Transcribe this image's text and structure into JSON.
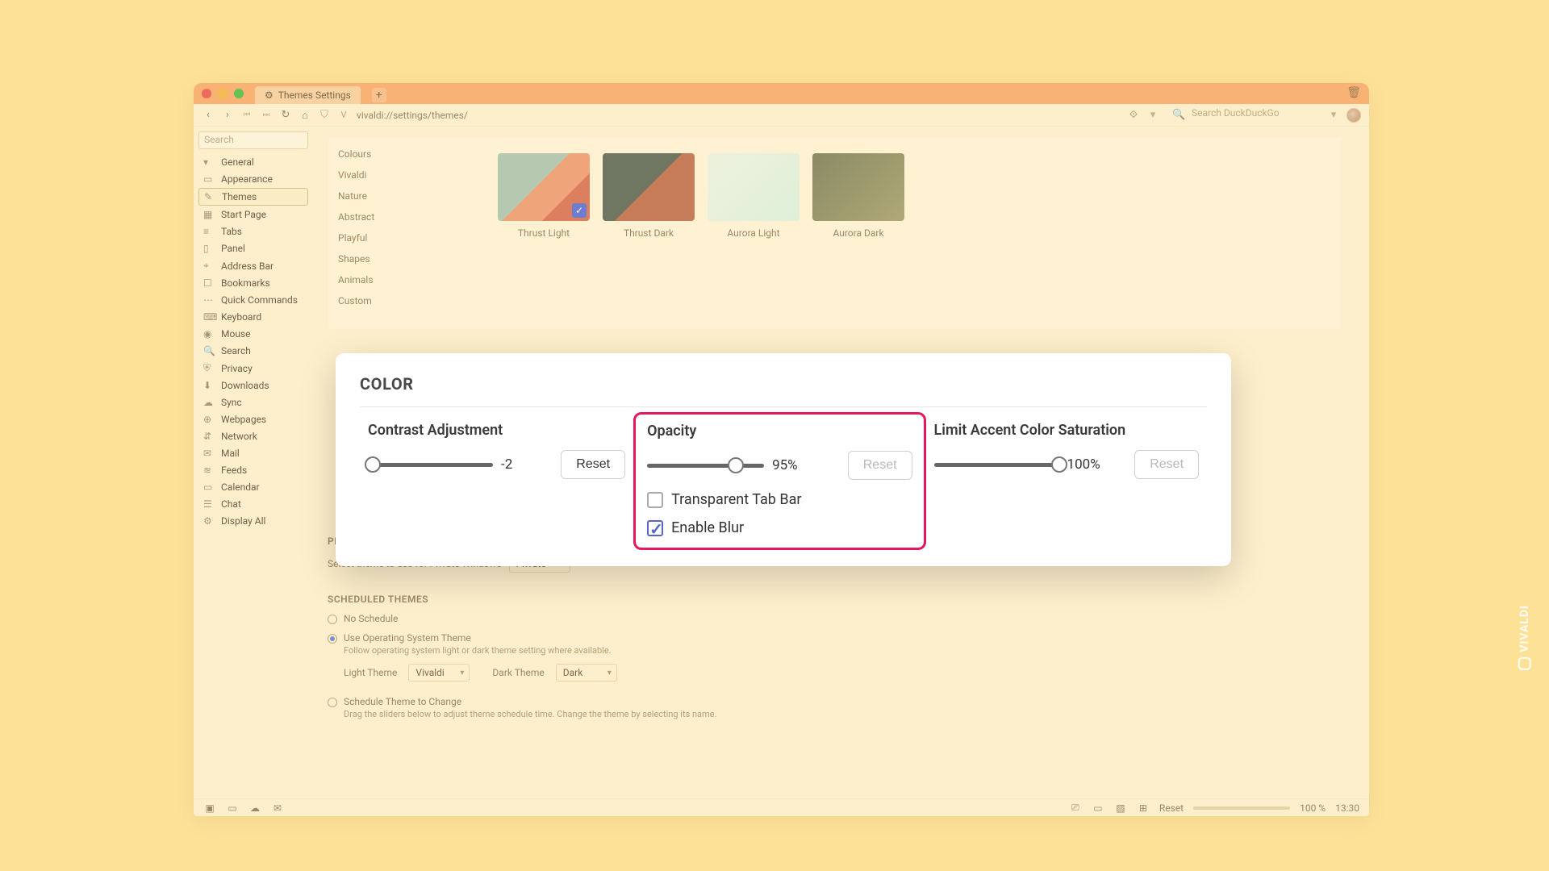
{
  "titlebar": {
    "tab_label": "Themes Settings",
    "new_tab_label": "+"
  },
  "nav": {
    "address": "vivaldi://settings/themes/",
    "search_placeholder": "Search DuckDuckGo"
  },
  "sidebar": {
    "search_placeholder": "Search",
    "items": [
      {
        "icon": "▾",
        "label": "General"
      },
      {
        "icon": "▭",
        "label": "Appearance"
      },
      {
        "icon": "✎",
        "label": "Themes"
      },
      {
        "icon": "▦",
        "label": "Start Page"
      },
      {
        "icon": "≡",
        "label": "Tabs"
      },
      {
        "icon": "▯",
        "label": "Panel"
      },
      {
        "icon": "⌖",
        "label": "Address Bar"
      },
      {
        "icon": "☐",
        "label": "Bookmarks"
      },
      {
        "icon": "⋯",
        "label": "Quick Commands"
      },
      {
        "icon": "⌨",
        "label": "Keyboard"
      },
      {
        "icon": "◉",
        "label": "Mouse"
      },
      {
        "icon": "🔍",
        "label": "Search"
      },
      {
        "icon": "⛨",
        "label": "Privacy"
      },
      {
        "icon": "⬇",
        "label": "Downloads"
      },
      {
        "icon": "☁",
        "label": "Sync"
      },
      {
        "icon": "⊕",
        "label": "Webpages"
      },
      {
        "icon": "⇵",
        "label": "Network"
      },
      {
        "icon": "✉",
        "label": "Mail"
      },
      {
        "icon": "≋",
        "label": "Feeds"
      },
      {
        "icon": "▭",
        "label": "Calendar"
      },
      {
        "icon": "☰",
        "label": "Chat"
      },
      {
        "icon": "⚙",
        "label": "Display All"
      }
    ],
    "selected_index": 2
  },
  "categories": [
    "Colours",
    "Vivaldi",
    "Nature",
    "Abstract",
    "Playful",
    "Shapes",
    "Animals",
    "Custom"
  ],
  "thumbs": [
    {
      "label": "Thrust Light",
      "cls": "th-a",
      "selected": true
    },
    {
      "label": "Thrust Dark",
      "cls": "th-b",
      "selected": false
    },
    {
      "label": "Aurora Light",
      "cls": "th-c",
      "selected": false
    },
    {
      "label": "Aurora Dark",
      "cls": "th-d",
      "selected": false
    }
  ],
  "private_theme": {
    "heading": "PRIVATE WINDOW THEME",
    "text": "Select theme to use for Private Windows",
    "value": "Private"
  },
  "scheduled": {
    "heading": "SCHEDULED THEMES",
    "no_schedule": "No Schedule",
    "use_os": "Use Operating System Theme",
    "use_os_sub": "Follow operating system light or dark theme setting where available.",
    "light_label": "Light Theme",
    "light_value": "Vivaldi",
    "dark_label": "Dark Theme",
    "dark_value": "Dark",
    "schedule_change": "Schedule Theme to Change",
    "schedule_sub": "Drag the sliders below to adjust theme schedule time. Change the theme by selecting its name."
  },
  "color_panel": {
    "heading": "COLOR",
    "contrast": {
      "label": "Contrast Adjustment",
      "value": "-2",
      "reset": "Reset",
      "pos": 4
    },
    "opacity": {
      "label": "Opacity",
      "value": "95%",
      "reset": "Reset",
      "pos": 76,
      "transparent": "Transparent Tab Bar",
      "transparent_on": false,
      "blur": "Enable Blur",
      "blur_on": true
    },
    "saturation": {
      "label": "Limit Accent Color Saturation",
      "value": "100%",
      "reset": "Reset",
      "pos": 100
    }
  },
  "status": {
    "reset": "Reset",
    "zoom": "100 %",
    "time": "13:30"
  },
  "brand": "VIVALDI"
}
